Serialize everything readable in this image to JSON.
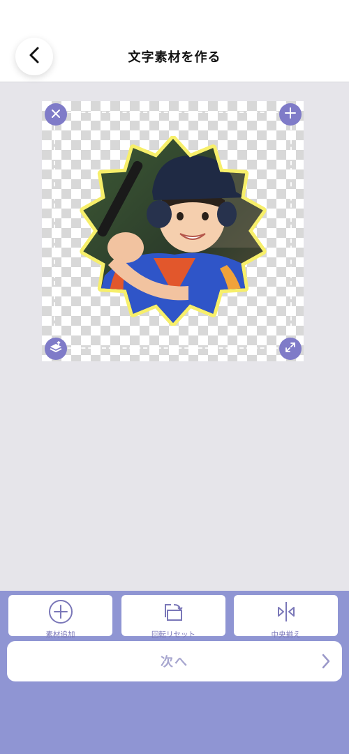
{
  "header": {
    "title": "文字素材を作る",
    "back_icon": "chevron-left-icon"
  },
  "canvas": {
    "handles": {
      "top_left": "close-icon",
      "top_right": "plus-icon",
      "bottom_left": "layer-up-icon",
      "bottom_right": "expand-icon"
    },
    "accent_color": "#7f7bc8",
    "outline_color": "#f7ef6a"
  },
  "toolbar": {
    "add_label": "素材追加",
    "add_icon": "plus-circle-icon",
    "rotate_label": "回転リセット",
    "rotate_icon": "rotate-reset-icon",
    "center_label": "中央揃え",
    "center_icon": "align-center-icon"
  },
  "next": {
    "label": "次へ",
    "icon": "chevron-right-icon"
  },
  "colors": {
    "panel": "#8f95d3",
    "label": "#7a77b8",
    "next_label": "#a7a6cf"
  }
}
